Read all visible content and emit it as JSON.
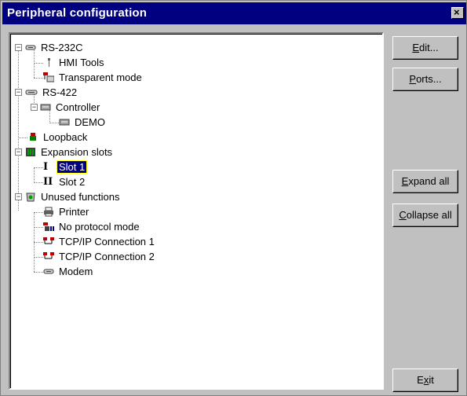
{
  "window": {
    "title": "Peripheral configuration",
    "close_glyph": "×"
  },
  "tree": [
    {
      "label": "RS-232C",
      "icon": "serial-port-icon",
      "expanded": true
    },
    {
      "label": "HMI Tools",
      "icon": "tools-icon"
    },
    {
      "label": "Transparent mode",
      "icon": "transparent-mode-icon"
    },
    {
      "label": "RS-422",
      "icon": "serial-port-icon",
      "expanded": true
    },
    {
      "label": "Controller",
      "icon": "controller-icon",
      "expanded": true
    },
    {
      "label": "DEMO",
      "icon": "controller-icon"
    },
    {
      "label": "Loopback",
      "icon": "loopback-icon"
    },
    {
      "label": "Expansion slots",
      "icon": "expansion-slots-icon",
      "expanded": true
    },
    {
      "label": "Slot 1",
      "icon": "slot-1-icon",
      "selected": true
    },
    {
      "label": "Slot 2",
      "icon": "slot-2-icon"
    },
    {
      "label": "Unused functions",
      "icon": "recycle-bin-icon",
      "expanded": true
    },
    {
      "label": "Printer",
      "icon": "printer-icon"
    },
    {
      "label": "No protocol mode",
      "icon": "no-protocol-icon"
    },
    {
      "label": "TCP/IP Connection 1",
      "icon": "network-icon"
    },
    {
      "label": "TCP/IP Connection 2",
      "icon": "network-icon"
    },
    {
      "label": "Modem",
      "icon": "modem-icon"
    }
  ],
  "buttons": {
    "edit": {
      "mn": "E",
      "rest": "dit..."
    },
    "ports": {
      "mn": "P",
      "rest": "orts..."
    },
    "expand": {
      "mn": "E",
      "rest": "xpand all"
    },
    "collapse": {
      "mn": "C",
      "rest": "ollapse all"
    },
    "exit": {
      "pre": "E",
      "mn": "x",
      "rest": "it"
    }
  }
}
